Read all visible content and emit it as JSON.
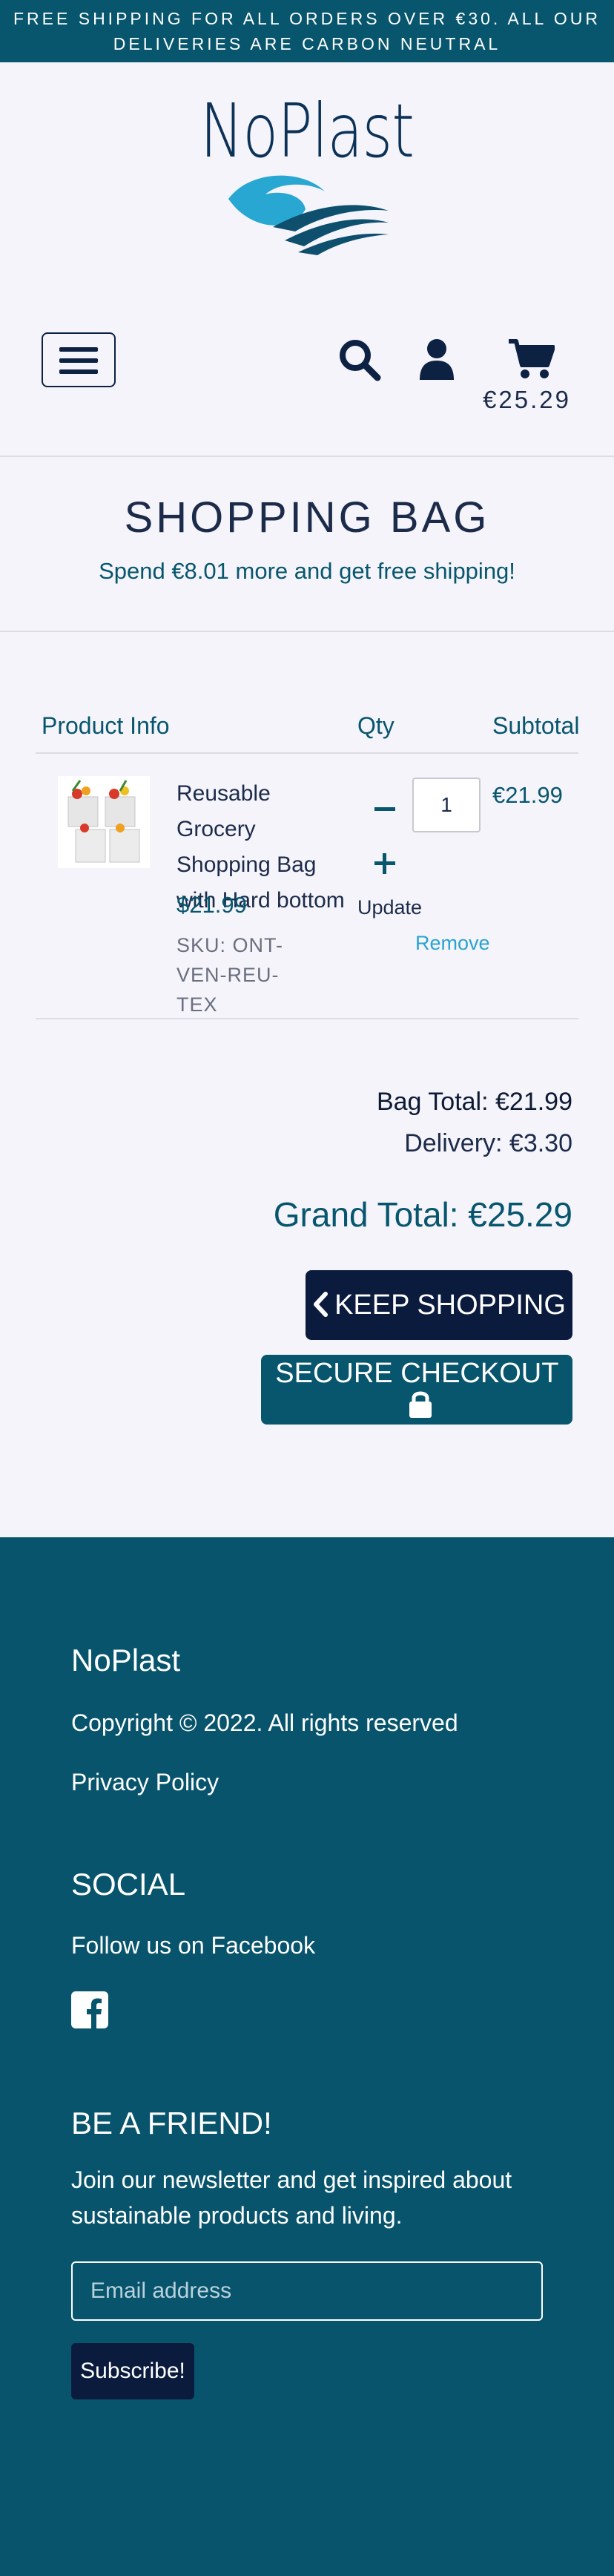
{
  "announcement": "FREE SHIPPING FOR ALL ORDERS OVER €30. ALL OUR DELIVERIES ARE CARBON NEUTRAL",
  "brand": {
    "logo_text": "NoPlast",
    "colors": {
      "primary": "#08566e",
      "navy": "#0b1b3e",
      "accent": "#2aa3d0"
    }
  },
  "header": {
    "icons": [
      "menu-icon",
      "search-icon",
      "user-icon",
      "cart-icon"
    ],
    "cart_total": "€25.29"
  },
  "bag": {
    "title": "SHOPPING BAG",
    "free_shipping_note": "Spend €8.01 more and get free shipping!",
    "columns": [
      "Product Info",
      "Qty",
      "Subtotal"
    ],
    "items": [
      {
        "name": "Reusable Grocery Shopping Bag with Hard bottom",
        "price": "$21.99",
        "sku": "SKU: ONT-VEN-REU-TEX",
        "qty": "1",
        "update_label": "Update",
        "remove_label": "Remove",
        "subtotal": "€21.99"
      }
    ]
  },
  "totals": {
    "bag_total": "Bag Total: €21.99",
    "delivery": "Delivery: €3.30",
    "grand_total": "Grand Total: €25.29"
  },
  "actions": {
    "keep_shopping": "KEEP SHOPPING",
    "secure_checkout": "SECURE CHECKOUT"
  },
  "footer": {
    "brand": "NoPlast",
    "copyright": "Copyright © 2022. All rights reserved",
    "privacy": "Privacy Policy",
    "social_heading": "SOCIAL",
    "social_text": "Follow us on Facebook",
    "friend_heading": "BE A FRIEND!",
    "friend_text": "Join our newsletter and get inspired about sustainable products and living.",
    "email_placeholder": "Email address",
    "subscribe_label": "Subscribe!"
  }
}
